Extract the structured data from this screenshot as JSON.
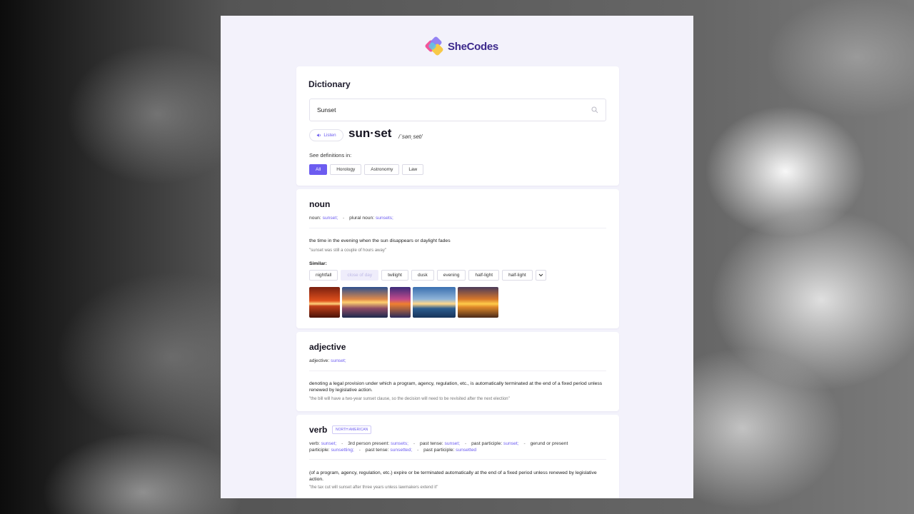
{
  "brand": {
    "name": "SheCodes"
  },
  "dictionary": {
    "title": "Dictionary",
    "search_value": "Sunset",
    "listen_label": "Listen",
    "word": "sun·set",
    "phonetic": "/ˈsənˌset/",
    "see_definitions_label": "See definitions in:",
    "categories": [
      "All",
      "Horology",
      "Astronomy",
      "Law"
    ],
    "active_category": "All"
  },
  "noun": {
    "label": "noun",
    "forms": {
      "noun_label": "noun:",
      "noun_value": "sunset;",
      "plural_label": "plural noun:",
      "plural_value": "sunsets;"
    },
    "definition": "the time in the evening when the sun disappears or daylight fades",
    "example": "\"sunset was still a couple of hours away\"",
    "similar_label": "Similar:",
    "similar": [
      "nightfall",
      "close of day",
      "twilight",
      "dusk",
      "evening",
      "half-light",
      "half-light"
    ],
    "similar_muted_index": 1
  },
  "adjective": {
    "label": "adjective",
    "forms": {
      "adj_label": "adjective:",
      "adj_value": "sunset;"
    },
    "definition": "denoting a legal provision under which a program, agency, regulation, etc., is automatically terminated at the end of a fixed period unless renewed by legislative action.",
    "example": "\"the bill will have a two-year sunset clause, so the decision will need to be revisited after the next election\""
  },
  "verb": {
    "label": "verb",
    "badge": "NORTH AMERICAN",
    "forms": {
      "verb_label": "verb:",
      "verb_value": "sunset;",
      "third_label": "3rd person present:",
      "third_value": "sunsets;",
      "past_label": "past tense:",
      "past_value": "sunset;",
      "pp_label": "past participle:",
      "pp_value": "sunset;",
      "ger_label": "gerund or present participle:",
      "ger_value": "sunsetting;",
      "past2_label": "past tense:",
      "past2_value": "sunsetted;",
      "pp2_label": "past participle:",
      "pp2_value": "sunsetted"
    },
    "definition": "(of a program, agency, regulation, etc.) expire or be terminated automatically at the end of a fixed period unless renewed by legislative action.",
    "example": "\"the tax cut will sunset after three years unless lawmakers extend it\""
  },
  "colors": {
    "accent": "#6c5cf0",
    "page_bg": "#f3f2fb"
  }
}
